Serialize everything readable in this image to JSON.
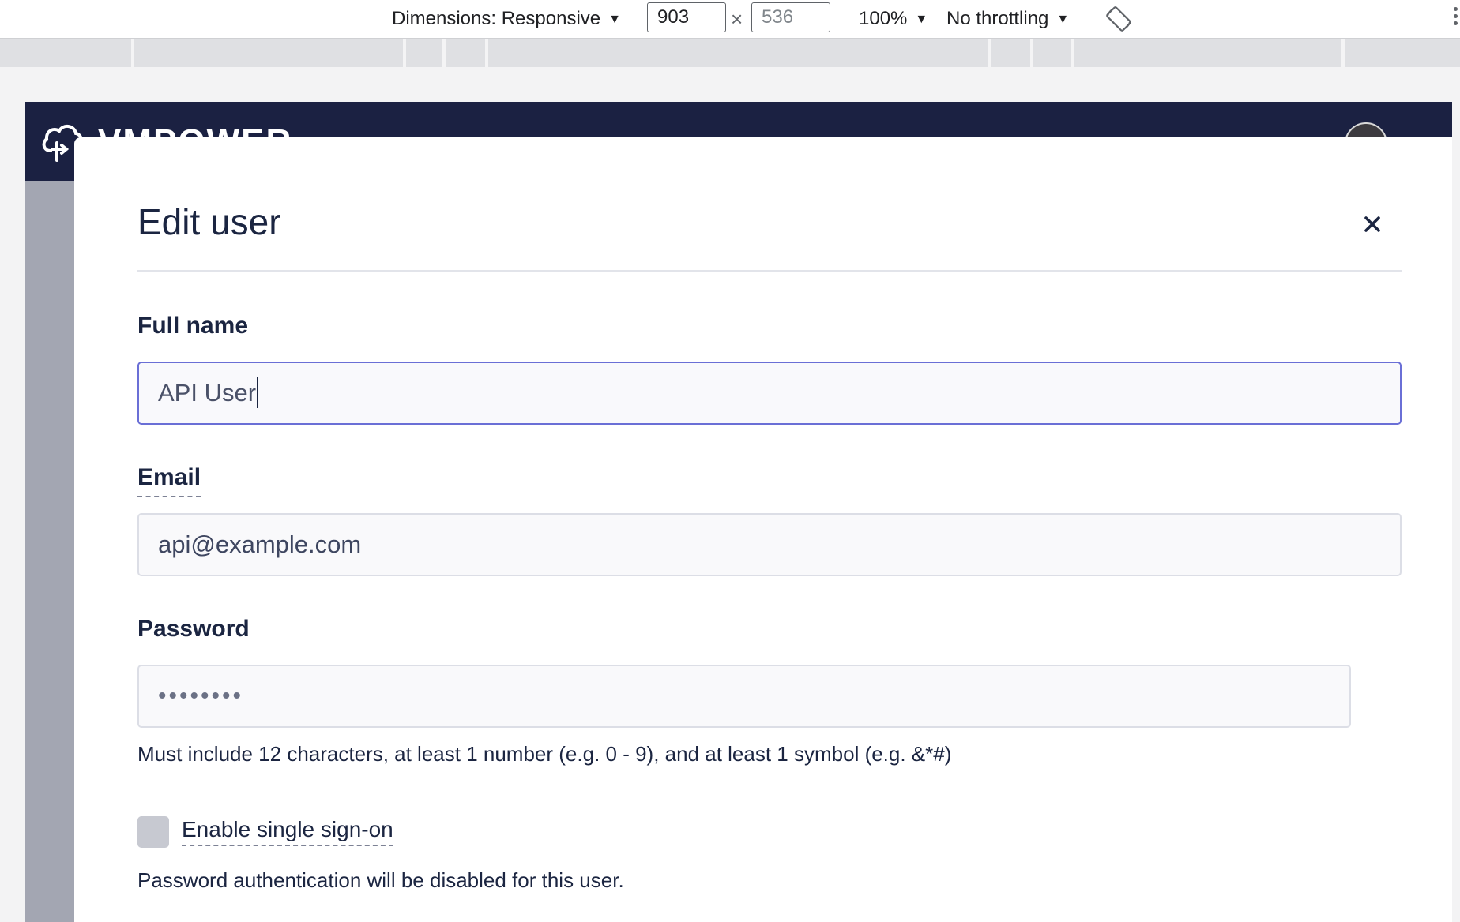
{
  "devtools": {
    "dimensions_label": "Dimensions: Responsive",
    "width_value": "903",
    "height_value": "536",
    "times_glyph": "×",
    "zoom_label": "100%",
    "throttling_label": "No throttling"
  },
  "app": {
    "brand": "VMPOWER"
  },
  "modal": {
    "title": "Edit user",
    "full_name": {
      "label": "Full name",
      "value": "API User"
    },
    "email": {
      "label": "Email",
      "value": "api@example.com"
    },
    "password": {
      "label": "Password",
      "value": "••••••••",
      "help": "Must include 12 characters, at least 1 number (e.g. 0 - 9), and at least 1 symbol (e.g. &*#)"
    },
    "sso": {
      "label": "Enable single sign-on",
      "checked": false,
      "help": "Password authentication will be disabled for this user."
    }
  },
  "colors": {
    "header_bg": "#1b2142",
    "focus_border": "#6a6fd6",
    "text": "#1b2541"
  },
  "icons": [
    "caret-down-icon",
    "rotate-icon",
    "more-vert-icon",
    "cloud-logo-icon",
    "close-icon"
  ]
}
